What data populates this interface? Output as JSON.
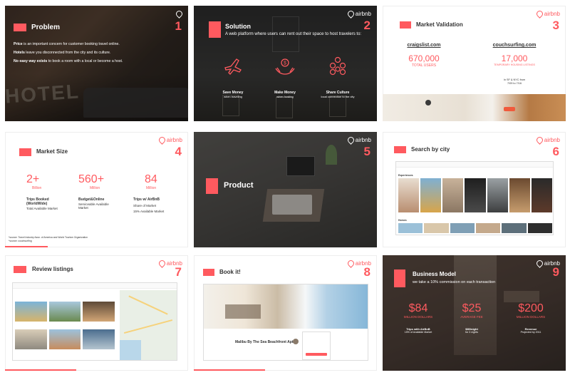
{
  "logo_text": "airbnb",
  "accent": "#ff5a5f",
  "slides": [
    {
      "number": "1",
      "title": "Problem",
      "lines": [
        {
          "bold": "Price",
          "rest": " is an important concern for customer booking travel online."
        },
        {
          "bold": "Hotels",
          "rest": " leave you disconnected from the city and its culture."
        },
        {
          "bold": "No easy way exists",
          "rest": " to book a room with a local or become a host."
        }
      ],
      "sign_text": "HOTEL"
    },
    {
      "number": "2",
      "title": "Solution",
      "subtitle": "A web platform where users can rent out their space to host travelers to:",
      "items": [
        {
          "icon": "plane-icon",
          "label": "Save Money",
          "sub": "when traveling"
        },
        {
          "icon": "money-hands-icon",
          "label": "Make Money",
          "sub": "when hosting"
        },
        {
          "icon": "people-icon",
          "label": "Share Culture",
          "sub": "local connection to the city"
        }
      ]
    },
    {
      "number": "3",
      "title": "Market Validation",
      "sites": [
        {
          "name": "craigslist.com",
          "value": "670,000",
          "caption": "TOTAL USERS"
        },
        {
          "name": "couchsurfing.com",
          "value": "17,000",
          "caption": "TEMPORARY HOUSING LISTINGS"
        }
      ],
      "note_1": "In SF & NYC from",
      "note_2": "7/09 to 7/16"
    },
    {
      "number": "4",
      "title": "Market Size",
      "columns": [
        {
          "value": "2+",
          "unit": "Billion",
          "head": "Trips Booked (WorldWide)",
          "sub": "Total Available Market"
        },
        {
          "value": "560+",
          "unit": "Million",
          "head": "Budget&Online",
          "sub": "Serviceable Available Market"
        },
        {
          "value": "84",
          "unit": "Million",
          "head": "Trips w/ AirBnB",
          "sub": "Share of Market",
          "sub2": "15% Available Market"
        }
      ],
      "footnote_1": "*source: Travel Industry Assn. of America and World Tourism Organization",
      "footnote_2": "*source: couchsurfing"
    },
    {
      "number": "5",
      "title": "Product"
    },
    {
      "number": "6",
      "title": "Search by city",
      "section_1": "Experiences",
      "section_2": "Homes"
    },
    {
      "number": "7",
      "title": "Review listings"
    },
    {
      "number": "8",
      "title": "Book it!",
      "listing_title": "Malibu By The Sea Beachfront Apt"
    },
    {
      "number": "9",
      "title": "Business Model",
      "subtitle": "we take a 10% commission on each transaction",
      "columns": [
        {
          "value": "$84",
          "caption": "MILLION DOLLARS",
          "head": "Trips with AirBnB",
          "sub": "15% of Available Market"
        },
        {
          "value": "$25",
          "caption": "AVERAGE FEE",
          "head": "$80/night",
          "sub": "for 3 nights"
        },
        {
          "value": "$200",
          "caption": "MILLION DOLLARS",
          "head": "Revenue",
          "sub": "Projected by 2011"
        }
      ]
    }
  ]
}
